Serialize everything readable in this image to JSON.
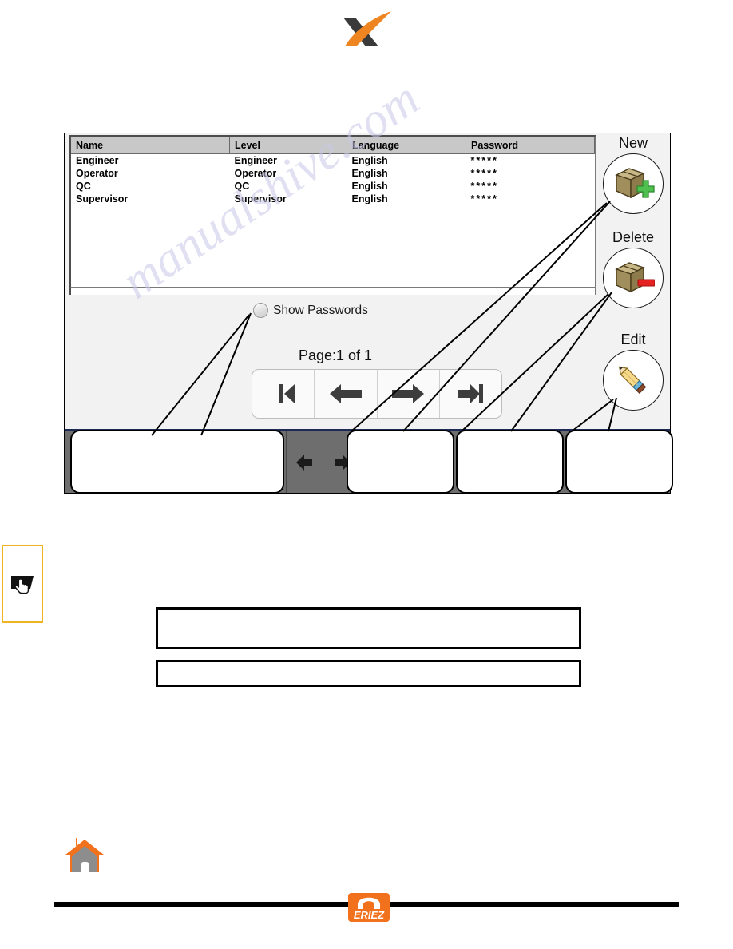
{
  "document": {
    "brand_logo": "x-swoosh-logo",
    "footer_logo": "eriez-logo",
    "footer_logo_text": "ERIEZ",
    "home_icon": "home-icon",
    "touch_icon": "touchscreen-hand-icon",
    "watermark_text": "manualshive.com"
  },
  "hmi": {
    "table": {
      "headers": [
        "Name",
        "Level",
        "Language",
        "Password"
      ],
      "rows": [
        {
          "name": "Engineer",
          "level": "Engineer",
          "language": "English",
          "password": "*****"
        },
        {
          "name": "Operator",
          "level": "Operator",
          "language": "English",
          "password": "*****"
        },
        {
          "name": "QC",
          "level": "QC",
          "language": "English",
          "password": "*****"
        },
        {
          "name": "Supervisor",
          "level": "Supervisor",
          "language": "English",
          "password": "*****"
        }
      ]
    },
    "show_passwords": {
      "label": "Show Passwords",
      "checked": false,
      "icon": "radio-circle-icon"
    },
    "pagination": {
      "page_text": "Page:1 of 1",
      "buttons": [
        {
          "name": "first-page",
          "icon": "first-page-arrow-icon"
        },
        {
          "name": "previous-page",
          "icon": "left-arrow-icon"
        },
        {
          "name": "next-page",
          "icon": "right-arrow-icon"
        },
        {
          "name": "last-page",
          "icon": "last-page-arrow-icon"
        }
      ]
    },
    "actions": [
      {
        "label": "New",
        "icon": "box-plus-icon"
      },
      {
        "label": "Delete",
        "icon": "box-minus-icon"
      },
      {
        "label": "Edit",
        "icon": "pencil-icon"
      }
    ],
    "toolbar": {
      "nav_back_icon": "nav-back-icon",
      "nav_forward_icon": "nav-forward-icon"
    }
  },
  "annotations": {
    "callouts": [
      {
        "name": "callout-show-passwords"
      },
      {
        "name": "callout-new"
      },
      {
        "name": "callout-delete"
      },
      {
        "name": "callout-edit"
      }
    ],
    "notes": [
      {
        "name": "note-box-primary"
      },
      {
        "name": "note-box-secondary"
      }
    ]
  },
  "colors": {
    "accent_orange": "#f2711c",
    "toolbar_blue": "#1c2a55",
    "toolbar_gray": "#6e6e6e",
    "toolbar_green": "#145214",
    "header_gray": "#c8c8c8",
    "note_border_yellow": "#f0b323"
  }
}
